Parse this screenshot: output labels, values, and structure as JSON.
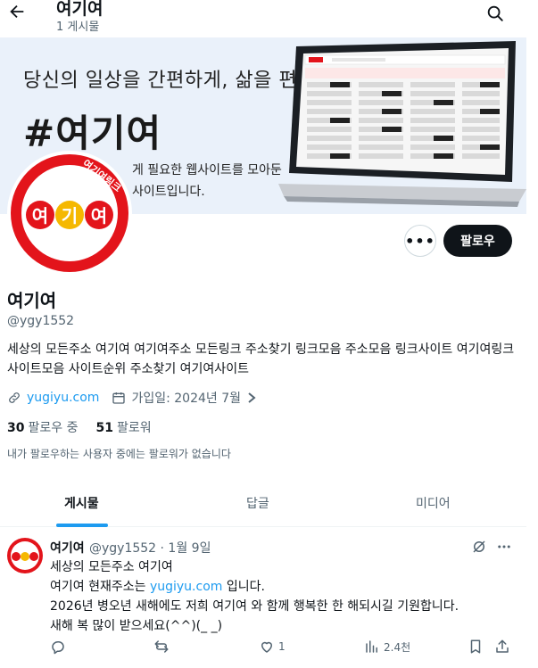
{
  "header": {
    "title": "여기여",
    "subtitle": "1 게시물",
    "back_icon": "arrow-left-icon",
    "search_icon": "search-icon"
  },
  "banner": {
    "headline": "당신의 일상을 간편하게, 삶을 편안하게",
    "hashtag": "#여기여",
    "line1": "게 필요한 웹사이트를 모아둔",
    "line2": "사이트입니다."
  },
  "avatar": {
    "word": "여기여",
    "ribbon": "여기여링크"
  },
  "actions": {
    "more": "•••",
    "follow": "팔로우"
  },
  "profile": {
    "name": "여기여",
    "handle": "@ygy1552",
    "bio": "세상의 모든주소 여기여 여기여주소 모든링크 주소찾기 링크모음 주소모음 링크사이트 여기여링크 사이트모음 사이트순위 주소찾기 여기여사이트",
    "website": "yugiyu.com",
    "joined": "가입일: 2024년 7월",
    "following_count": "30",
    "following_label": "팔로우 중",
    "followers_count": "51",
    "followers_label": "팔로워",
    "follow_note": "내가 팔로우하는 사용자 중에는 팔로워가 없습니다"
  },
  "tabs": [
    "게시물",
    "답글",
    "미디어"
  ],
  "tweet": {
    "author": "여기여",
    "handle_date": "@ygy1552 · 1월 9일",
    "line1": "세상의 모든주소 여기여",
    "line2_pre": "여기여 현재주소는 ",
    "line2_url": "yugiyu.com",
    "line2_post": " 입니다.",
    "line3": "2026년 병오년 새해에도 저희 여기여 와 함께 행복한 한 해되시길 기원합니다.",
    "line4": "새해 복 많이 받으세요(^^)(_ _)",
    "likes": "1",
    "views": "2.4천"
  },
  "colors": {
    "accent": "#1d9bf0",
    "brand_red": "#e3141b",
    "brand_yellow": "#f5b800",
    "banner_bg": "#eaf1fa"
  }
}
